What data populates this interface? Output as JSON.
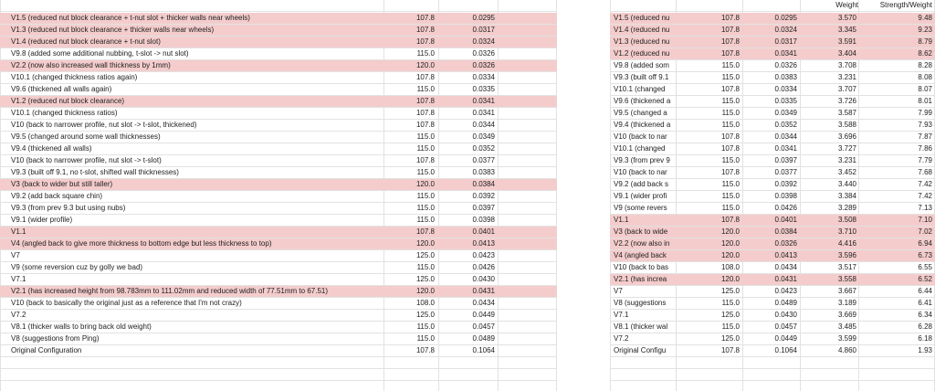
{
  "colors": {
    "highlight": "#f4cccc",
    "gridline": "#e2e2e2",
    "background": "#ffffff"
  },
  "left_table": {
    "rows": [
      {
        "label": "V1.5 (reduced nut block clearance + t-nut slot + thicker walls near wheels)",
        "a": "107.8",
        "b": "0.0295",
        "hl": true
      },
      {
        "label": "V1.3 (reduced nut block clearance + thicker walls near wheels)",
        "a": "107.8",
        "b": "0.0317",
        "hl": true
      },
      {
        "label": "V1.4 (reduced nut block clearance + t-nut slot)",
        "a": "107.8",
        "b": "0.0324",
        "hl": true
      },
      {
        "label": "V9.8 (added some additional nubbing, t-slot -> nut slot)",
        "a": "115.0",
        "b": "0.0326",
        "hl": false
      },
      {
        "label": "V2.2 (now also increased wall thickness by 1mm)",
        "a": "120.0",
        "b": "0.0326",
        "hl": true
      },
      {
        "label": "V10.1 (changed thickness ratios again)",
        "a": "107.8",
        "b": "0.0334",
        "hl": false
      },
      {
        "label": "V9.6 (thickened all walls again)",
        "a": "115.0",
        "b": "0.0335",
        "hl": false
      },
      {
        "label": "V1.2 (reduced nut block clearance)",
        "a": "107.8",
        "b": "0.0341",
        "hl": true
      },
      {
        "label": "V10.1 (changed thickness ratios)",
        "a": "107.8",
        "b": "0.0341",
        "hl": false
      },
      {
        "label": "V10 (back to narrower profile, nut slot -> t-slot, thickened)",
        "a": "107.8",
        "b": "0.0344",
        "hl": false
      },
      {
        "label": "V9.5 (changed around some wall thicknesses)",
        "a": "115.0",
        "b": "0.0349",
        "hl": false
      },
      {
        "label": "V9.4 (thickened all walls)",
        "a": "115.0",
        "b": "0.0352",
        "hl": false
      },
      {
        "label": "V10 (back to narrower profile, nut slot -> t-slot)",
        "a": "107.8",
        "b": "0.0377",
        "hl": false
      },
      {
        "label": "V9.3 (built off 9.1, no t-slot, shifted wall thicknesses)",
        "a": "115.0",
        "b": "0.0383",
        "hl": false
      },
      {
        "label": "V3 (back to wider but still taller)",
        "a": "120.0",
        "b": "0.0384",
        "hl": true
      },
      {
        "label": "V9.2 (add back square chin)",
        "a": "115.0",
        "b": "0.0392",
        "hl": false
      },
      {
        "label": "V9.3 (from prev 9.3 but using nubs)",
        "a": "115.0",
        "b": "0.0397",
        "hl": false
      },
      {
        "label": "V9.1 (wider profile)",
        "a": "115.0",
        "b": "0.0398",
        "hl": false
      },
      {
        "label": "V1.1",
        "a": "107.8",
        "b": "0.0401",
        "hl": true
      },
      {
        "label": "V4 (angled back to give more thickness to bottom edge but less thickness to top)",
        "a": "120.0",
        "b": "0.0413",
        "hl": true
      },
      {
        "label": "V7",
        "a": "125.0",
        "b": "0.0423",
        "hl": false
      },
      {
        "label": "V9 (some reversion cuz by golly we bad)",
        "a": "115.0",
        "b": "0.0426",
        "hl": false
      },
      {
        "label": "V7.1",
        "a": "125.0",
        "b": "0.0430",
        "hl": false
      },
      {
        "label": "V2.1 (has increased height from 98.783mm to 111.02mm and reduced width of 77.51mm to 67.51)",
        "a": "120.0",
        "b": "0.0431",
        "hl": true
      },
      {
        "label": "V10 (back to basically the original just as a reference that I'm not crazy)",
        "a": "108.0",
        "b": "0.0434",
        "hl": false
      },
      {
        "label": "V7.2",
        "a": "125.0",
        "b": "0.0449",
        "hl": false
      },
      {
        "label": "V8.1 (thicker walls to bring back old weight)",
        "a": "115.0",
        "b": "0.0457",
        "hl": false
      },
      {
        "label": "V8 (suggestions from Ping)",
        "a": "115.0",
        "b": "0.0489",
        "hl": false
      },
      {
        "label": "Original Configuration",
        "a": "107.8",
        "b": "0.1064",
        "hl": false
      }
    ]
  },
  "right_table": {
    "header": {
      "weight": "Weight",
      "strength_weight": "Strength/Weight"
    },
    "rows": [
      {
        "label": "V1.5 (reduced nu",
        "a": "107.8",
        "b": "0.0295",
        "w": "3.570",
        "sw": "9.48",
        "hl": true
      },
      {
        "label": "V1.4 (reduced nu",
        "a": "107.8",
        "b": "0.0324",
        "w": "3.345",
        "sw": "9.23",
        "hl": true
      },
      {
        "label": "V1.3 (reduced nu",
        "a": "107.8",
        "b": "0.0317",
        "w": "3.591",
        "sw": "8.79",
        "hl": true
      },
      {
        "label": "V1.2 (reduced nu",
        "a": "107.8",
        "b": "0.0341",
        "w": "3.404",
        "sw": "8.62",
        "hl": true
      },
      {
        "label": "V9.8 (added som",
        "a": "115.0",
        "b": "0.0326",
        "w": "3.708",
        "sw": "8.28",
        "hl": false
      },
      {
        "label": "V9.3 (built off 9.1",
        "a": "115.0",
        "b": "0.0383",
        "w": "3.231",
        "sw": "8.08",
        "hl": false
      },
      {
        "label": "V10.1 (changed",
        "a": "107.8",
        "b": "0.0334",
        "w": "3.707",
        "sw": "8.07",
        "hl": false
      },
      {
        "label": "V9.6 (thickened a",
        "a": "115.0",
        "b": "0.0335",
        "w": "3.726",
        "sw": "8.01",
        "hl": false
      },
      {
        "label": "V9.5 (changed a",
        "a": "115.0",
        "b": "0.0349",
        "w": "3.587",
        "sw": "7.99",
        "hl": false
      },
      {
        "label": "V9.4 (thickened a",
        "a": "115.0",
        "b": "0.0352",
        "w": "3.588",
        "sw": "7.93",
        "hl": false
      },
      {
        "label": "V10 (back to nar",
        "a": "107.8",
        "b": "0.0344",
        "w": "3.696",
        "sw": "7.87",
        "hl": false
      },
      {
        "label": "V10.1 (changed",
        "a": "107.8",
        "b": "0.0341",
        "w": "3.727",
        "sw": "7.86",
        "hl": false
      },
      {
        "label": "V9.3 (from prev 9",
        "a": "115.0",
        "b": "0.0397",
        "w": "3.231",
        "sw": "7.79",
        "hl": false
      },
      {
        "label": "V10 (back to nar",
        "a": "107.8",
        "b": "0.0377",
        "w": "3.452",
        "sw": "7.68",
        "hl": false
      },
      {
        "label": "V9.2 (add back s",
        "a": "115.0",
        "b": "0.0392",
        "w": "3.440",
        "sw": "7.42",
        "hl": false
      },
      {
        "label": "V9.1 (wider profi",
        "a": "115.0",
        "b": "0.0398",
        "w": "3.384",
        "sw": "7.42",
        "hl": false
      },
      {
        "label": "V9 (some revers",
        "a": "115.0",
        "b": "0.0426",
        "w": "3.289",
        "sw": "7.13",
        "hl": false
      },
      {
        "label": "V1.1",
        "a": "107.8",
        "b": "0.0401",
        "w": "3.508",
        "sw": "7.10",
        "hl": true
      },
      {
        "label": "V3 (back to wide",
        "a": "120.0",
        "b": "0.0384",
        "w": "3.710",
        "sw": "7.02",
        "hl": true
      },
      {
        "label": "V2.2 (now also in",
        "a": "120.0",
        "b": "0.0326",
        "w": "4.416",
        "sw": "6.94",
        "hl": true
      },
      {
        "label": "V4 (angled back",
        "a": "120.0",
        "b": "0.0413",
        "w": "3.596",
        "sw": "6.73",
        "hl": true
      },
      {
        "label": "V10 (back to bas",
        "a": "108.0",
        "b": "0.0434",
        "w": "3.517",
        "sw": "6.55",
        "hl": false
      },
      {
        "label": "V2.1 (has increa",
        "a": "120.0",
        "b": "0.0431",
        "w": "3.558",
        "sw": "6.52",
        "hl": true
      },
      {
        "label": "V7",
        "a": "125.0",
        "b": "0.0423",
        "w": "3.667",
        "sw": "6.44",
        "hl": false
      },
      {
        "label": "V8 (suggestions",
        "a": "115.0",
        "b": "0.0489",
        "w": "3.189",
        "sw": "6.41",
        "hl": false
      },
      {
        "label": "V7.1",
        "a": "125.0",
        "b": "0.0430",
        "w": "3.669",
        "sw": "6.34",
        "hl": false
      },
      {
        "label": "V8.1 (thicker wal",
        "a": "115.0",
        "b": "0.0457",
        "w": "3.485",
        "sw": "6.28",
        "hl": false
      },
      {
        "label": "V7.2",
        "a": "125.0",
        "b": "0.0449",
        "w": "3.599",
        "sw": "6.18",
        "hl": false
      },
      {
        "label": "Original Configu",
        "a": "107.8",
        "b": "0.1064",
        "w": "4.860",
        "sw": "1.93",
        "hl": false
      }
    ]
  }
}
